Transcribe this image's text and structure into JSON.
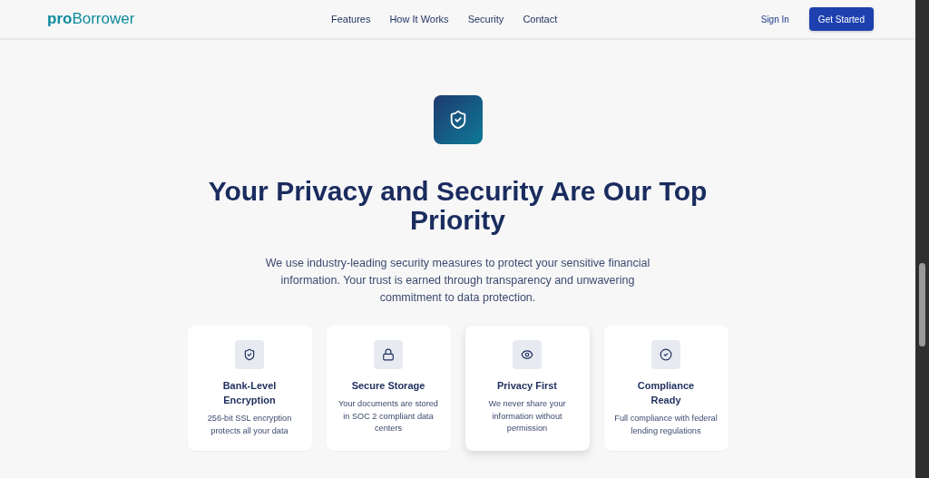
{
  "nav": {
    "logo": "**pro**Borrower",
    "links": [
      "Features",
      "How It Works",
      "Security",
      "Contact"
    ],
    "sign_in": "Sign In",
    "cta": "Get Started"
  },
  "hero": {
    "title": "Your Privacy and Security Are Our Top Priority",
    "description": "We use industry-leading security measures to protect your sensitive financial information. Your trust is earned through transparency and unwavering commitment to data protection."
  },
  "features": [
    {
      "kind": "shield",
      "title": "Bank-Level Encryption",
      "text": "256-bit SSL encryption protects all your data",
      "hovered": false
    },
    {
      "kind": "lock",
      "title": "Secure Storage",
      "text": "Your documents are stored in SOC 2 compliant data centers",
      "hovered": false
    },
    {
      "kind": "eye",
      "title": "Privacy First",
      "text": "We never share your information without permission",
      "hovered": true
    },
    {
      "kind": "check",
      "title": "Compliance Ready",
      "text": "Full compliance with federal lending regulations",
      "hovered": false
    }
  ]
}
